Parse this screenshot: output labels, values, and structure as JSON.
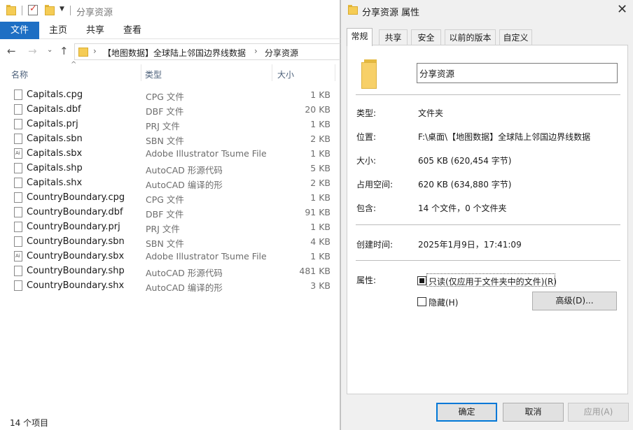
{
  "explorer": {
    "title": "分享资源",
    "ribbon_tabs": [
      "文件",
      "主页",
      "共享",
      "查看"
    ],
    "breadcrumb": [
      "【地图数据】全球陆上邻国边界线数据",
      "分享资源"
    ],
    "columns": {
      "name": "名称",
      "type": "类型",
      "size": "大小"
    },
    "files": [
      {
        "name": "Capitals.cpg",
        "type": "CPG 文件",
        "size": "1 KB",
        "icon": "file-icon"
      },
      {
        "name": "Capitals.dbf",
        "type": "DBF 文件",
        "size": "20 KB",
        "icon": "file-icon"
      },
      {
        "name": "Capitals.prj",
        "type": "PRJ 文件",
        "size": "1 KB",
        "icon": "file-icon"
      },
      {
        "name": "Capitals.sbn",
        "type": "SBN 文件",
        "size": "2 KB",
        "icon": "file-icon"
      },
      {
        "name": "Capitals.sbx",
        "type": "Adobe Illustrator Tsume File",
        "size": "1 KB",
        "icon": "illustrator-file-icon"
      },
      {
        "name": "Capitals.shp",
        "type": "AutoCAD 形源代码",
        "size": "5 KB",
        "icon": "file-icon"
      },
      {
        "name": "Capitals.shx",
        "type": "AutoCAD 编译的形",
        "size": "2 KB",
        "icon": "file-icon"
      },
      {
        "name": "CountryBoundary.cpg",
        "type": "CPG 文件",
        "size": "1 KB",
        "icon": "file-icon"
      },
      {
        "name": "CountryBoundary.dbf",
        "type": "DBF 文件",
        "size": "91 KB",
        "icon": "file-icon"
      },
      {
        "name": "CountryBoundary.prj",
        "type": "PRJ 文件",
        "size": "1 KB",
        "icon": "file-icon"
      },
      {
        "name": "CountryBoundary.sbn",
        "type": "SBN 文件",
        "size": "4 KB",
        "icon": "file-icon"
      },
      {
        "name": "CountryBoundary.sbx",
        "type": "Adobe Illustrator Tsume File",
        "size": "1 KB",
        "icon": "illustrator-file-icon"
      },
      {
        "name": "CountryBoundary.shp",
        "type": "AutoCAD 形源代码",
        "size": "481 KB",
        "icon": "file-icon"
      },
      {
        "name": "CountryBoundary.shx",
        "type": "AutoCAD 编译的形",
        "size": "3 KB",
        "icon": "file-icon"
      }
    ],
    "status": "14 个项目"
  },
  "dialog": {
    "title": "分享资源 属性",
    "tabs": [
      "常规",
      "共享",
      "安全",
      "以前的版本",
      "自定义"
    ],
    "active_tab": "常规",
    "folder_name": "分享资源",
    "props": {
      "type_label": "类型:",
      "type_value": "文件夹",
      "location_label": "位置:",
      "location_value": "F:\\桌面\\【地图数据】全球陆上邻国边界线数据",
      "size_label": "大小:",
      "size_value": "605 KB (620,454 字节)",
      "disk_label": "占用空间:",
      "disk_value": "620 KB (634,880 字节)",
      "contains_label": "包含:",
      "contains_value": "14 个文件，0 个文件夹",
      "created_label": "创建时间:",
      "created_value": "2025年1月9日，17:41:09",
      "attributes_label": "属性:"
    },
    "readonly_label": "只读(仅应用于文件夹中的文件)(R)",
    "readonly_state": "indeterminate",
    "hidden_label": "隐藏(H)",
    "hidden_state": "unchecked",
    "advanced_label": "高级(D)...",
    "buttons": {
      "ok": "确定",
      "cancel": "取消",
      "apply": "应用(A)"
    }
  },
  "colors": {
    "accent": "#1e6fc4",
    "folder": "#f5cc55",
    "dialog_bg": "#f0f0f0",
    "primary_border": "#0078d7"
  }
}
